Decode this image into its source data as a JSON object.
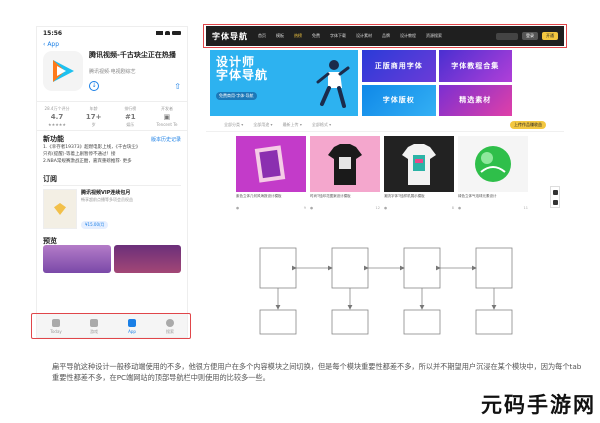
{
  "phone": {
    "status_time": "15:56",
    "back_label": "App",
    "app_title": "腾讯视频-千古玦尘正在热播",
    "app_sub": "腾讯视频·电视剧综艺",
    "stats": [
      {
        "top": "28.4万个评分",
        "value": "4.7",
        "bottom": "★★★★★"
      },
      {
        "top": "年龄",
        "value": "17+",
        "bottom": "岁"
      },
      {
        "top": "排行榜",
        "value": "#1",
        "bottom": "娱乐"
      },
      {
        "top": "开发者",
        "value": "",
        "bottom": "Tencent Te"
      }
    ],
    "news": {
      "title": "新功能",
      "link": "版本历史记录",
      "lines": [
        "1.《幸存者19373》超燃电影上线，《千古玦尘》",
        "只有(提醒)·等着上剧暂停不通过！接",
        "2.NBA常规赛激战正酣，嘉宾重磅推荐·  更多"
      ],
      "more": "更多"
    },
    "subscription": {
      "title": "订阅",
      "name": "腾讯视频VIP连续包月",
      "desc": "畅享超前点播等多项会员权益",
      "price": "¥15.00/月"
    },
    "preview_title": "预览",
    "tabs": [
      {
        "label": "Today",
        "active": false
      },
      {
        "label": "游戏",
        "active": false
      },
      {
        "label": "App",
        "active": true
      },
      {
        "label": "搜索",
        "active": false
      }
    ]
  },
  "web": {
    "logo": "字体导航",
    "nav": [
      "首页",
      "模板",
      "热榜",
      "免费",
      "字体下载",
      "设计素材",
      "品牌",
      "设计教程",
      "资源搜索"
    ],
    "nav_hot_index": 2,
    "login": "登录",
    "vip": "开通",
    "hero_line1": "设计师",
    "hero_line2": "字体导航",
    "hero_sub": "免费商用·字体·导航",
    "tiles": [
      "正版商用字体",
      "字体教程合集",
      "字体版权",
      "精选素材"
    ],
    "filters": [
      "全部分类",
      "全部用途",
      "最新上传",
      "全部格式"
    ],
    "filter_pill": "上传作品赚收益",
    "products": [
      {
        "caption": "紫色立体几何风海报设计模板",
        "views": "9"
      },
      {
        "caption": "时尚T恤印花图案设计模板",
        "views": "12"
      },
      {
        "caption": "潮流字体T恤样机展示模板",
        "views": "8"
      },
      {
        "caption": "绿色立体气泡球元素设计",
        "views": "11"
      }
    ]
  },
  "paragraph": "扁平导航这种设计一般移动端使用的不多，他很方便用户在多个内容模块之间切换，但是每个模块重要性都差不多，所以并不期望用户沉浸在某个模块中，因为每个tab重要性都差不多，在PC端网站的顶部导航栏中则使用的比较多一些。",
  "watermark": "元码手游网",
  "colors": {
    "outline": "#e0464a",
    "ios_blue": "#1a7fe6",
    "nav_bg": "#1f1f1f",
    "accent_yellow": "#f3c740",
    "hero_blue": "#2db2f0"
  }
}
